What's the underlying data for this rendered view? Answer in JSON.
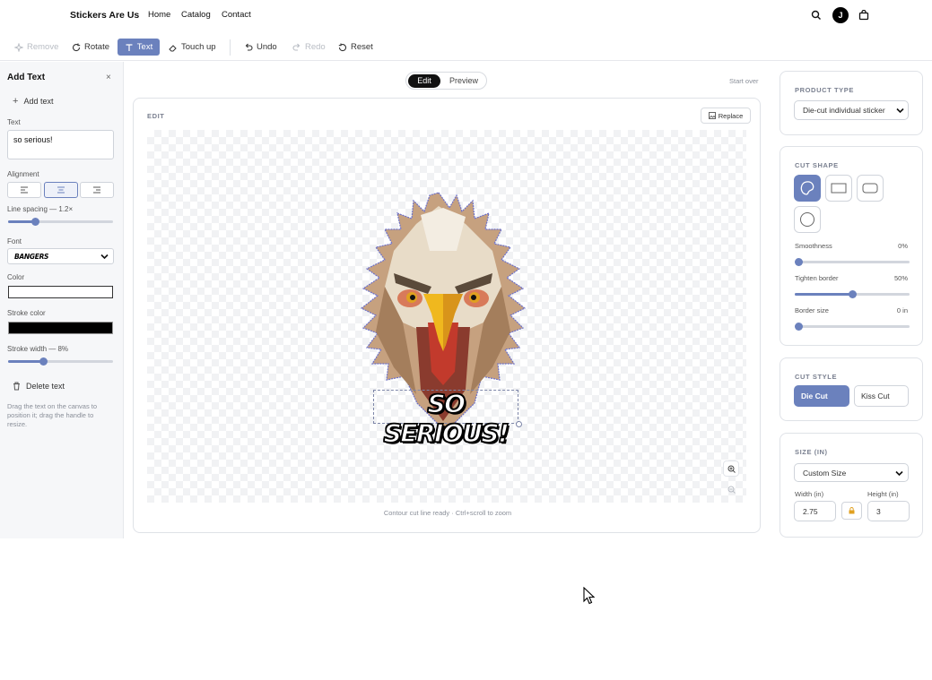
{
  "header": {
    "brand": "Stickers Are Us",
    "nav": [
      "Home",
      "Catalog",
      "Contact"
    ],
    "avatar_initial": "J",
    "icons": [
      "search-icon",
      "avatar",
      "cart-icon"
    ]
  },
  "toolbar": {
    "remove": "Remove",
    "rotate": "Rotate",
    "text": "Text",
    "touch_up": "Touch up",
    "undo": "Undo",
    "redo": "Redo",
    "reset": "Reset"
  },
  "left_panel": {
    "title": "Add Text",
    "add_text": "Add text",
    "text_label": "Text",
    "text_value": "so serious!",
    "alignment_label": "Alignment",
    "alignment_selected": "center",
    "line_spacing_label": "Line spacing — 1.2×",
    "line_spacing_value": 1.2,
    "font_label": "Font",
    "font_value": "BANGERS",
    "color_label": "Color",
    "color_value": "#ffffff",
    "stroke_color_label": "Stroke color",
    "stroke_color_value": "#000000",
    "stroke_width_label": "Stroke width — 8%",
    "stroke_width_value": 8,
    "delete_text": "Delete text",
    "hint": "Drag the text on the canvas to position it; drag the handle to resize."
  },
  "center": {
    "tabs": [
      "Edit",
      "Preview"
    ],
    "active_tab": "Edit",
    "start_over": "Start over",
    "section_label": "EDIT",
    "replace": "Replace",
    "overlay_text": "SO SERIOUS!",
    "status": "Contour cut line ready · Ctrl+scroll to zoom"
  },
  "right_panel": {
    "product_type_label": "PRODUCT TYPE",
    "product_type_value": "Die-cut individual sticker",
    "cut_shape_label": "CUT SHAPE",
    "cut_shapes": [
      "contour",
      "rectangle",
      "rounded-rectangle",
      "circle"
    ],
    "cut_shape_selected": "contour",
    "smoothness_label": "Smoothness",
    "smoothness_value": "0%",
    "tighten_label": "Tighten border",
    "tighten_value": "50%",
    "border_label": "Border size",
    "border_value": "0 in",
    "cut_style_label": "CUT STYLE",
    "die_cut": "Die Cut",
    "kiss_cut": "Kiss Cut",
    "size_label": "SIZE (IN)",
    "size_value": "Custom Size",
    "width_label": "Width (in)",
    "height_label": "Height (in)",
    "width_value": "2.75",
    "height_value": "3"
  },
  "colors": {
    "accent": "#6b81bd",
    "dark": "#111111",
    "border": "#dfe2e7"
  }
}
